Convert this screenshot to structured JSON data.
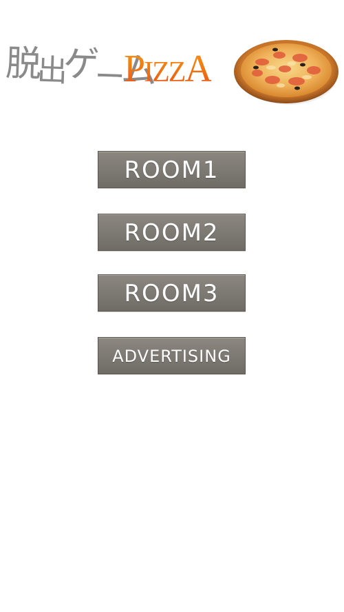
{
  "title": {
    "japanese": "脱出ゲーム",
    "japanese_chars": [
      "脱",
      "出",
      "ゲ",
      "ー",
      "ム"
    ],
    "english_big_1": "P",
    "english_small_1": "IZZ",
    "english_big_2": "A"
  },
  "menu": {
    "room1_label": "ROOM1",
    "room2_label": "ROOM2",
    "room3_label": "ROOM3",
    "advertising_label": "ADVERTISING"
  },
  "icons": {
    "logo_image": "pizza-image"
  },
  "colors": {
    "background": "#ffffff",
    "button": "#7c7872",
    "button_text": "#ffffff",
    "title_jp": "#8a8a8a",
    "title_en_top": "#f5a31a",
    "title_en_bottom": "#e0381a"
  }
}
